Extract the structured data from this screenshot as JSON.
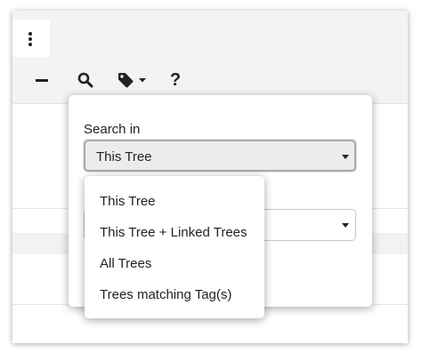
{
  "toolbar": {
    "overflow_icon": "kebab-vertical-icon",
    "collapse_icon": "minus-icon",
    "search_icon": "search-icon",
    "tag_icon": "tag-icon",
    "help_label": "?"
  },
  "search_popover": {
    "label": "Search in",
    "selected": "This Tree",
    "options": [
      "This Tree",
      "This Tree + Linked Trees",
      "All Trees",
      "Trees matching Tag(s)"
    ]
  }
}
